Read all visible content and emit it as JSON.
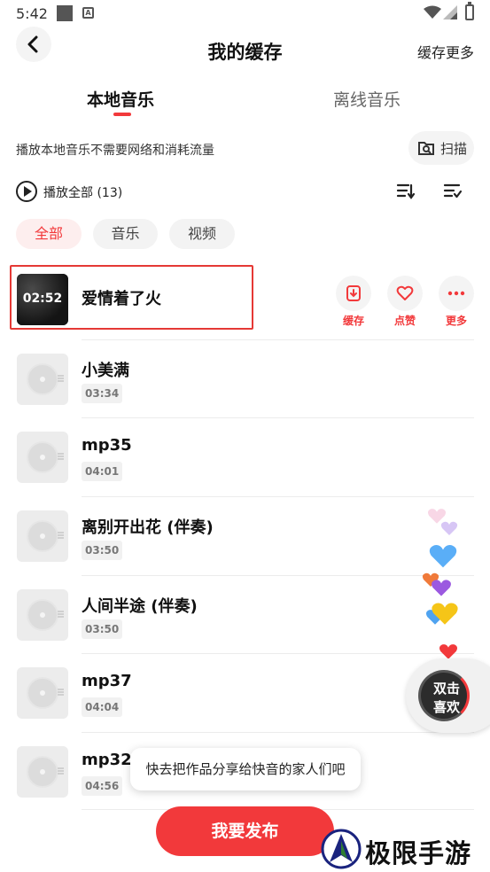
{
  "status_bar": {
    "time": "5:42",
    "a_icon_letter": "A"
  },
  "header": {
    "title": "我的缓存",
    "right_action": "缓存更多"
  },
  "tabs": [
    {
      "label": "本地音乐",
      "active": true
    },
    {
      "label": "离线音乐",
      "active": false
    }
  ],
  "hint": {
    "text": "播放本地音乐不需要网络和消耗流量",
    "scan_label": "扫描"
  },
  "play_all": {
    "label": "播放全部 (13)"
  },
  "filters": [
    {
      "label": "全部",
      "active": true
    },
    {
      "label": "音乐",
      "active": false
    },
    {
      "label": "视频",
      "active": false
    }
  ],
  "songs": [
    {
      "title": "爱情着了火",
      "duration": "02:52",
      "is_video": true,
      "actions": [
        {
          "label": "缓存",
          "icon": "download-icon"
        },
        {
          "label": "点赞",
          "icon": "heart-icon"
        },
        {
          "label": "更多",
          "icon": "more-icon"
        }
      ]
    },
    {
      "title": "小美满",
      "duration": "03:34"
    },
    {
      "title": "mp35",
      "duration": "04:01"
    },
    {
      "title": "离别开出花 (伴奏)",
      "duration": "03:50"
    },
    {
      "title": "人间半途 (伴奏)",
      "duration": "03:50"
    },
    {
      "title": "mp37",
      "duration": "04:04"
    },
    {
      "title": "mp32",
      "duration": "04:56"
    }
  ],
  "double_tap_like": {
    "line1": "双击",
    "line2": "喜欢"
  },
  "tooltip": "快去把作品分享给快音的家人们吧",
  "publish_button": "我要发布",
  "watermark": "极限手游网",
  "colors": {
    "accent": "#f2393b",
    "highlight_border": "#e53935"
  }
}
